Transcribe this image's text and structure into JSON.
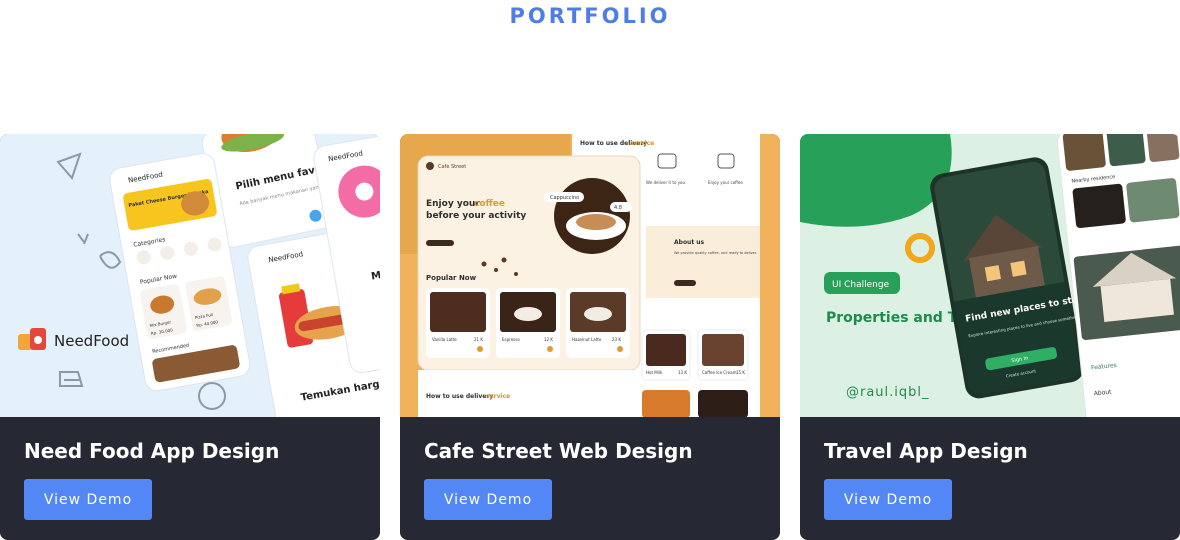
{
  "section": {
    "title": "PORTFOLIO"
  },
  "projects": [
    {
      "title": "Need Food App Design",
      "button": "View Demo",
      "thumb": {
        "brand": "NeedFood",
        "screen_a_heading": "Pilih menu favoritemu",
        "screen_a_sub": "Ada banyak menu makanan yang bisa dipilih",
        "screen_b_promo": "Paket Cheese Burger Lengka",
        "screen_b_categories": "Categories",
        "screen_b_popular": "Popular Now",
        "screen_b_item1": "Mix Burger",
        "screen_b_price1": "Rp. 30.000",
        "screen_b_item2": "Pizza Full",
        "screen_b_price2": "Rp. 40.000",
        "screen_b_recommended": "Recommended",
        "screen_c_heading": "Temukan harga terbaik",
        "screen_d_heading": "Makan siap d"
      }
    },
    {
      "title": "Cafe Street Web Design",
      "button": "View Demo",
      "thumb": {
        "logo": "Cafe Street",
        "hero_line1": "Enjoy your",
        "hero_accent": "coffee",
        "hero_line2": "before your activity",
        "popular": "Popular Now",
        "product_label": "Cappuccino",
        "rating": "4.8",
        "item1": "Vanilla Latte",
        "price1": "21 K",
        "item2": "Espresso",
        "price2": "12 K",
        "item3": "Hazelnut Latte",
        "price3": "23 K",
        "delivery_title": "How to use delivery",
        "delivery_accent": "service",
        "delivery_sub1": "We deliver it to you",
        "delivery_sub2": "Enjoy your coffee",
        "about_title": "About us",
        "about_sub": "We provide quality coffee, and ready to deliver.",
        "menu1": "Hot Milk",
        "menu1_price": "13 K",
        "menu2": "Coffee Ice Cream",
        "menu2_price": "15 K"
      }
    },
    {
      "title": "Travel App Design",
      "button": "View Demo",
      "thumb": {
        "badge": "UI Challenge",
        "headline": "Properties and Travel App",
        "handle": "@raul.iqbl_",
        "phone_headline": "Find new places to stay and homes",
        "phone_sub": "Explore interesting places to live and choose something for yourself",
        "phone_button": "Sign In",
        "phone_link": "Create account",
        "nearby": "Nearby residence",
        "features": "Features",
        "about": "About"
      }
    }
  ],
  "colors": {
    "accent": "#4f7de8",
    "button": "#5287f5",
    "card": "#262833"
  }
}
